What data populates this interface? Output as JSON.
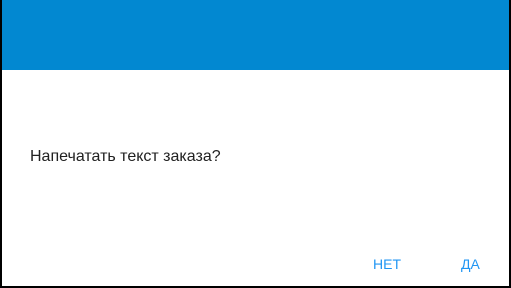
{
  "dialog": {
    "title_bar_color": "#0288d1",
    "message": "Напечатать текст заказа?",
    "buttons": {
      "no_label": "НЕТ",
      "yes_label": "ДА"
    },
    "accent_color": "#2196f3"
  }
}
